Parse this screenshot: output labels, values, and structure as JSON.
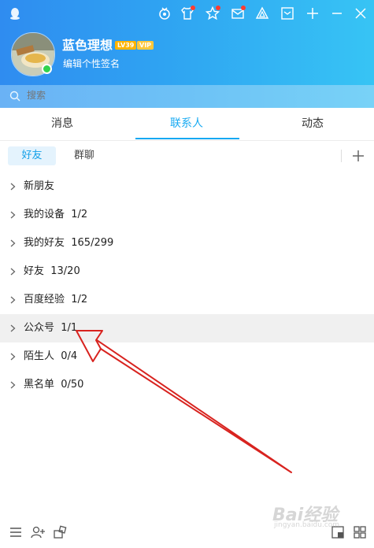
{
  "profile": {
    "nickname": "蓝色理想",
    "level_badge": "LV39",
    "vip_badge": "VIP",
    "signature": "编辑个性签名",
    "status": "online"
  },
  "topbar": {
    "icons": [
      "qq-logo-icon",
      "medal-icon",
      "tshirt-icon",
      "star-icon",
      "mail-icon",
      "triangle-icon",
      "inbox-icon",
      "plus-icon",
      "minimize-icon",
      "close-icon"
    ]
  },
  "search": {
    "placeholder": "搜索"
  },
  "tabs": [
    {
      "label": "消息",
      "active": false
    },
    {
      "label": "联系人",
      "active": true
    },
    {
      "label": "动态",
      "active": false
    }
  ],
  "subtabs": [
    {
      "label": "好友",
      "active": true
    },
    {
      "label": "群聊",
      "active": false
    }
  ],
  "groups": [
    {
      "label": "新朋友",
      "highlight": false
    },
    {
      "label": "我的设备  1/2",
      "highlight": false
    },
    {
      "label": "我的好友  165/299",
      "highlight": false
    },
    {
      "label": "好友  13/20",
      "highlight": false
    },
    {
      "label": "百度经验  1/2",
      "highlight": false
    },
    {
      "label": "公众号  1/1",
      "highlight": true
    },
    {
      "label": "陌生人  0/4",
      "highlight": false
    },
    {
      "label": "黑名单  0/50",
      "highlight": false
    }
  ],
  "annotation": {
    "color": "#d8231f"
  },
  "watermark": {
    "text": "Bai经验",
    "sub": "jingyan.baidu.com"
  },
  "colors": {
    "accent": "#16a8f2",
    "header_start": "#2f8cf0",
    "header_end": "#37c4f4"
  }
}
